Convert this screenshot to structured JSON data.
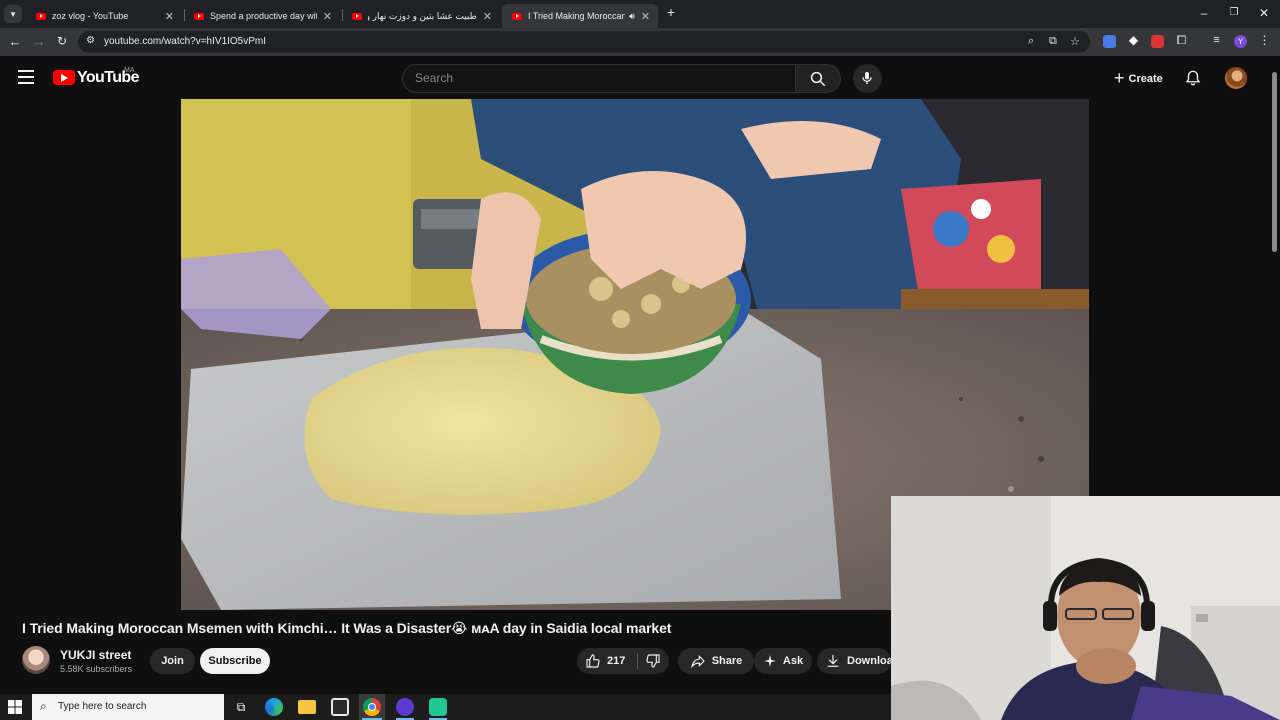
{
  "browser": {
    "tabs": [
      {
        "title": "zoz vlog - YouTube",
        "active": false
      },
      {
        "title": "Spend a productive day with m",
        "active": false
      },
      {
        "title": "طبيت عشا بتين و دوزت نهار واعر",
        "active": false
      },
      {
        "title": "I Tried Making Moroccan M",
        "active": true
      }
    ],
    "url": "youtube.com/watch?v=hIV1IO5vPmI"
  },
  "youtube": {
    "logo_text": "YouTube",
    "country_code": "MA",
    "search_placeholder": "Search",
    "create_label": "Create"
  },
  "video": {
    "title": "I Tried Making Moroccan Msemen with Kimchi… It Was a Disaster😭 ᴍᴀA day in Saidia local market",
    "channel_name": "YUKJI street",
    "subscribers": "5.58K subscribers",
    "join_label": "Join",
    "subscribe_label": "Subscribe",
    "likes": "217",
    "share_label": "Share",
    "ask_label": "Ask",
    "download_label": "Download"
  },
  "taskbar": {
    "search_placeholder": "Type here to search"
  },
  "colors": {
    "background": "#0f0f0f",
    "youtube_red": "#ff0000",
    "button_bg": "#272727",
    "subscribe_bg": "#f1f1f1"
  }
}
